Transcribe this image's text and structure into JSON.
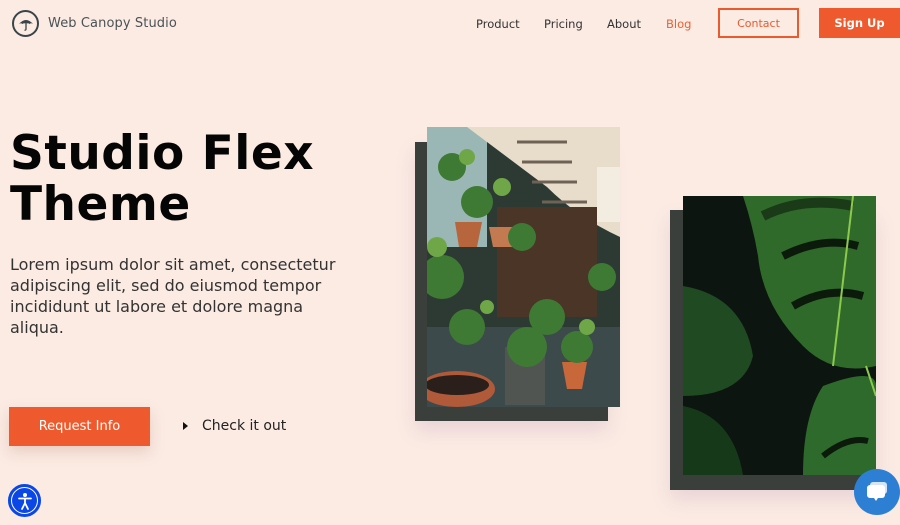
{
  "brand": {
    "name": "Web Canopy Studio",
    "icon": "umbrella-icon"
  },
  "nav": {
    "links": [
      {
        "label": "Product",
        "active": false
      },
      {
        "label": "Pricing",
        "active": false
      },
      {
        "label": "About",
        "active": false
      },
      {
        "label": "Blog",
        "active": true
      }
    ],
    "contact_label": "Contact",
    "signup_label": "Sign Up"
  },
  "hero": {
    "title_line1": "Studio Flex",
    "title_line2": "Theme",
    "description": "Lorem ipsum dolor sit amet, consectetur adipiscing elit, sed do eiusmod tempor incididunt ut labore et dolore magna aliqua.",
    "primary_cta": "Request Info",
    "secondary_cta": "Check it out"
  },
  "images": [
    {
      "subject": "indoor plants under spiral staircase"
    },
    {
      "subject": "monstera leaves"
    }
  ],
  "widgets": {
    "accessibility": "accessibility-icon",
    "chat": "chat-bubble-icon"
  },
  "colors": {
    "accent": "#ee5a2d",
    "background": "#fbebe3",
    "frame": "#3a3f3b"
  }
}
